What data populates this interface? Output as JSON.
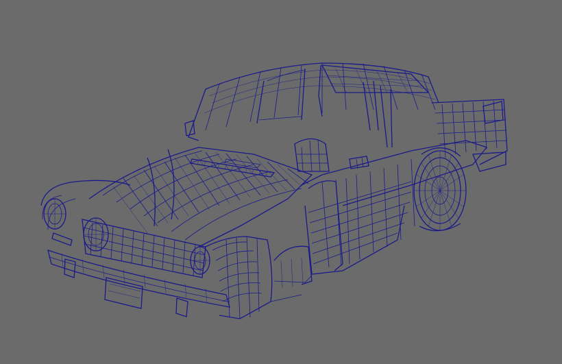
{
  "viewport": {
    "background_color": "#6b6b6b",
    "wireframe_color": "#1a1a8a",
    "display_mode": "wireframe"
  },
  "scene": {
    "object": "car-body-wireframe"
  }
}
